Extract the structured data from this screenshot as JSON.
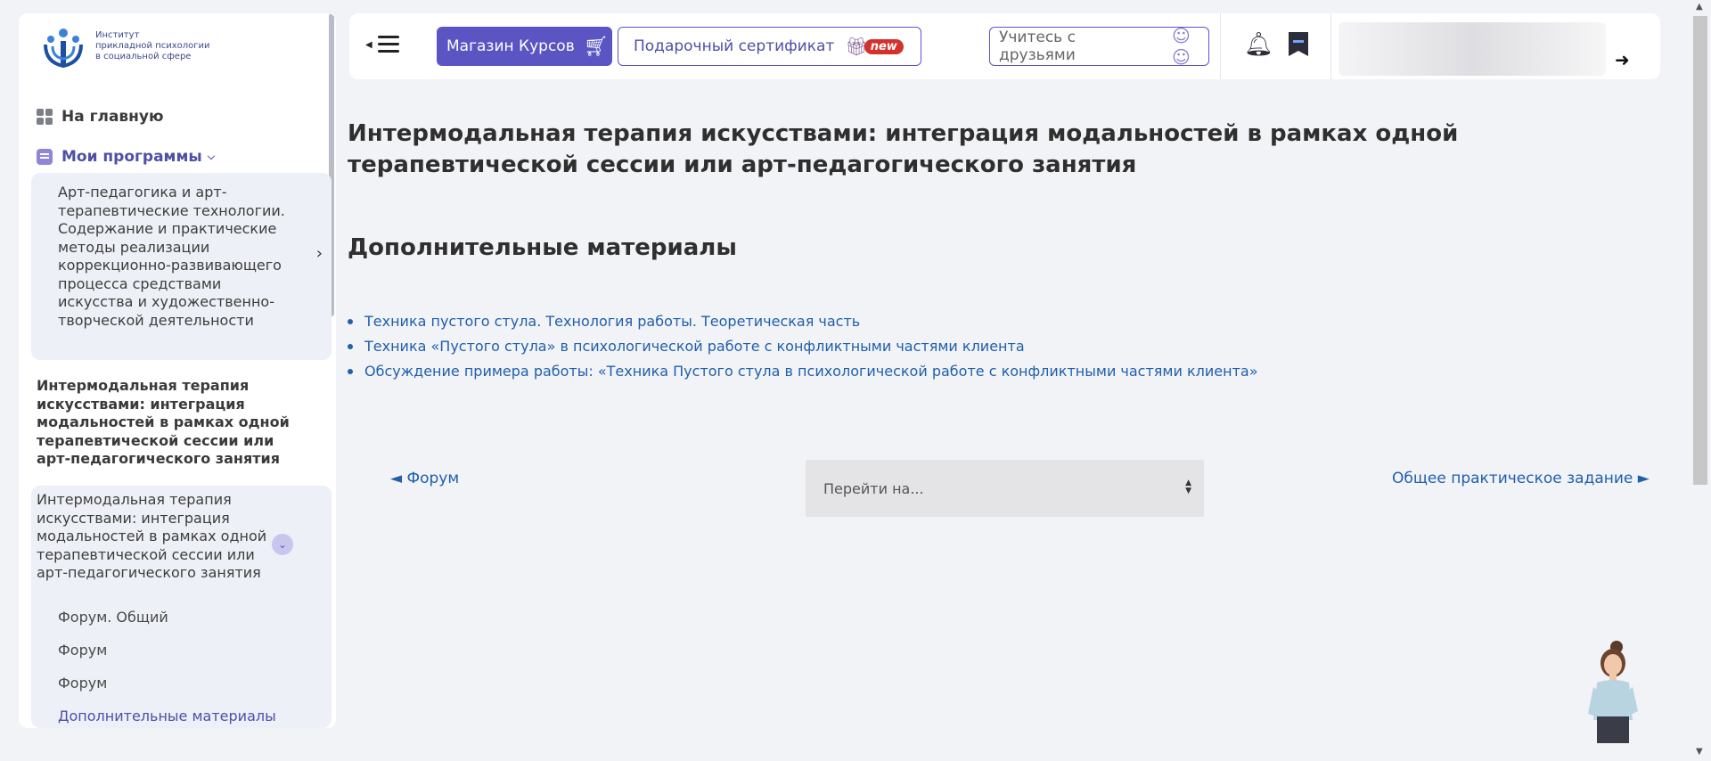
{
  "sidebar": {
    "logo_lines": [
      "Институт",
      "прикладной психологии",
      "в социальной сфере"
    ],
    "home_label": "На главную",
    "programs_label": "Мои программы",
    "program_card": "Арт-педагогика и арт-терапевтические технологии. Содержание и практические методы реализации коррекционно-развивающего процесса средствами искусства и художественно-творческой деятельности",
    "course_title": "Интермодальная терапия искусствами: интеграция модальностей в рамках одной терапевтической сессии или арт-педагогического занятия",
    "section_title": "Интермодальная терапия искусствами: интеграция модальностей в рамках одной терапевтической сессии или арт-педагогического занятия",
    "section_items": [
      "Форум. Общий",
      "Форум",
      "Форум",
      "Дополнительные материалы"
    ]
  },
  "header": {
    "shop_label": "Магазин Курсов",
    "gift_label": "Подарочный сертификат",
    "new_badge": "new",
    "friends_label": "Учитесь с друзьями"
  },
  "main": {
    "title": "Интермодальная терапия искусствами: интеграция модальностей в рамках одной терапевтической сессии или арт-педагогического занятия",
    "subtitle": "Дополнительные материалы",
    "links": [
      "Техника пустого стула. Технология работы. Теоретическая часть",
      "Техника «Пустого стула» в психологической работе с конфликтными частями клиента",
      "Обсуждение примера работы: «Техника Пустого стула в психологической работе с конфликтными частями клиента»"
    ],
    "prev_label": "◄ Форум",
    "next_label": "Общее практическое задание ►",
    "jump_placeholder": "Перейти на..."
  },
  "colors": {
    "accent": "#5b55c4",
    "link": "#1f5fab",
    "badge": "#d6302c"
  },
  "icons": [
    "logo-icon",
    "home-grid-icon",
    "programs-icon",
    "chevron-down-icon",
    "chevron-right-icon",
    "cart-icon",
    "gift-icon",
    "friends-icon",
    "bell-icon",
    "bookmark-icon",
    "logout-icon",
    "assistant-avatar"
  ]
}
